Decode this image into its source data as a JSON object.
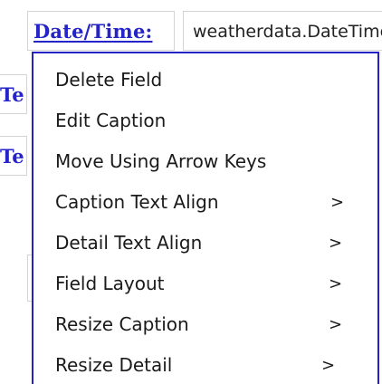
{
  "form": {
    "caption_label": "Date/Time:",
    "detail_value": "weatherdata.DateTime",
    "row2_label": "Te",
    "row3_label": "Te"
  },
  "context_menu": {
    "items": [
      {
        "label": "Delete Field",
        "submenu": ""
      },
      {
        "label": "Edit Caption",
        "submenu": ""
      },
      {
        "label": "Move Using Arrow Keys",
        "submenu": ""
      },
      {
        "label": "Caption Text Align",
        "submenu": ">"
      },
      {
        "label": "Detail Text Align",
        "submenu": ">"
      },
      {
        "label": "Field Layout",
        "submenu": ">"
      },
      {
        "label": "Resize Caption",
        "submenu": ">"
      },
      {
        "label": "Resize Detail",
        "submenu": ">"
      }
    ]
  },
  "colors": {
    "caption_blue": "#2424c8",
    "menu_border": "#2323c8",
    "field_border": "#d4d4d4"
  }
}
